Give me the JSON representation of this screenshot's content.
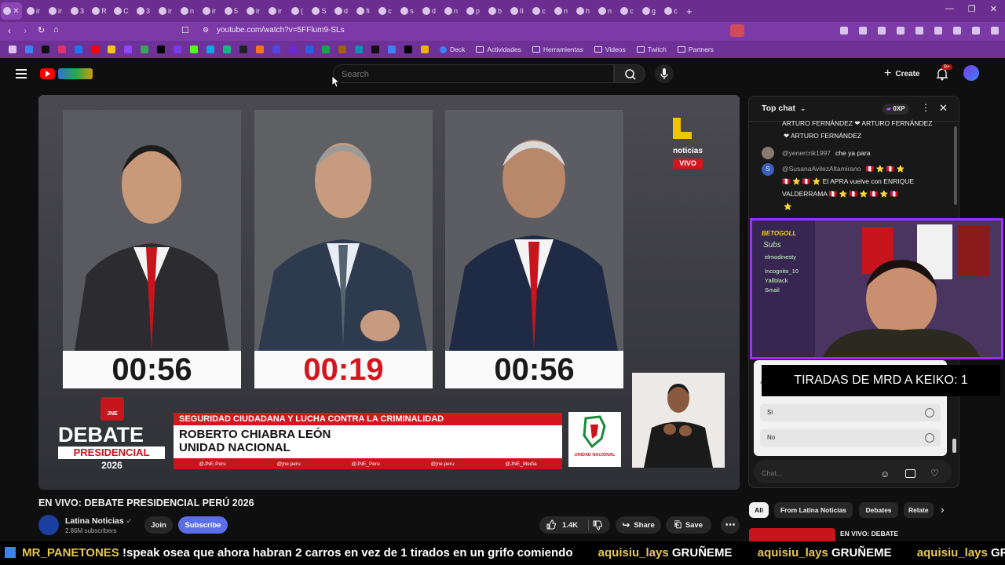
{
  "browser": {
    "url": "youtube.com/watch?v=5FFlum9-SLs",
    "tab_labels": [
      "ir",
      "ir",
      "3",
      "R",
      "C",
      "3",
      "ir",
      "n",
      "ir",
      "5",
      "ir",
      "ir",
      "(",
      "S",
      "d",
      "fi",
      "c",
      "s",
      "d",
      "n",
      "p",
      "b",
      "II",
      "c",
      "n",
      "h",
      "n",
      "c",
      "g",
      "c"
    ],
    "bookmarks": [
      "Deck",
      "Actividades",
      "Herramientas",
      "Videos",
      "Twitch",
      "Partners"
    ]
  },
  "youtube": {
    "search_placeholder": "Search",
    "create_label": "Create",
    "notifications_badge": "9+"
  },
  "video": {
    "timers": [
      "00:56",
      "00:19",
      "00:56"
    ],
    "topic": "SEGURIDAD CIUDADANA Y LUCHA CONTRA LA CRIMINALIDAD",
    "speaker_name": "ROBERTO CHIABRA LEÓN",
    "speaker_party": "UNIDAD NACIONAL",
    "socials": [
      "@JNE.Peru",
      "@jne.peru",
      "@JNE_Peru",
      "@jne.peru",
      "@JNE_Media"
    ],
    "debate_logo": {
      "top": "DEBATE",
      "middle": "PRESIDENCIAL",
      "year": "2026",
      "badge": "JNE"
    },
    "party_logo_text": "UNIDAD NACIONAL",
    "latina": {
      "label": "noticias",
      "live": "VIVO"
    }
  },
  "meta": {
    "title": "EN VIVO: DEBATE PRESIDENCIAL PERÚ 2026",
    "channel": "Latina Noticias",
    "subscribers": "2.86M subscribers",
    "join_label": "Join",
    "subscribe_label": "Subscribe",
    "likes": "1.4K",
    "share_label": "Share",
    "save_label": "Save"
  },
  "chat": {
    "header": "Top chat",
    "points": "0XP",
    "messages": [
      {
        "user": "",
        "text": "ARTURO FERNÁNDEZ ❤ ARTURO FERNÁNDEZ"
      },
      {
        "user": "",
        "text": "❤ ARTURO FERNÁNDEZ"
      },
      {
        "user": "@yenercrik1997",
        "text": "che ya para"
      },
      {
        "user": "@SusanaAvilezAltamirano",
        "text": "🇵🇪 ⭐ 🇵🇪 ⭐"
      },
      {
        "user": "",
        "text": "🇵🇪 ⭐ 🇵🇪 ⭐ El APRA vuelve con ENRIQUE"
      },
      {
        "user": "",
        "text": "VALDERRAMA 🇵🇪 ⭐ 🇵🇪 ⭐ 🇵🇪 ⭐ 🇵🇪"
      },
      {
        "user": "",
        "text": "⭐"
      }
    ],
    "poll": {
      "question": "¿",
      "options": [
        "Si",
        "No"
      ]
    },
    "input_placeholder": "Chat..."
  },
  "overlay": {
    "counter_text": "TIRADAS DE MRD A KEIKO: 1",
    "webcam_sidebar": [
      "BETOGOLL",
      "Subs",
      "elmodinesty",
      "Incognito_10",
      "Yallblack",
      "Smail"
    ]
  },
  "chips": [
    "All",
    "From Latina Noticias",
    "Debates",
    "Relate"
  ],
  "recommended_title": "EN VIVO: DEBATE",
  "ticker": [
    {
      "user": "MR_PANETONES",
      "text": "!speak osea que ahora habran 2 carros en vez de 1 tirados en un grifo comiendo"
    },
    {
      "user": "aquisiu_lays",
      "text": "GRUÑEME"
    },
    {
      "user": "aquisiu_lays",
      "text": "GRUÑEME"
    },
    {
      "user": "aquisiu_lays",
      "text": "GRUÑEME"
    }
  ],
  "colors": {
    "accent_purple": "#9b30ff",
    "jne_red": "#d4161f",
    "yt_red": "#ff0000"
  }
}
